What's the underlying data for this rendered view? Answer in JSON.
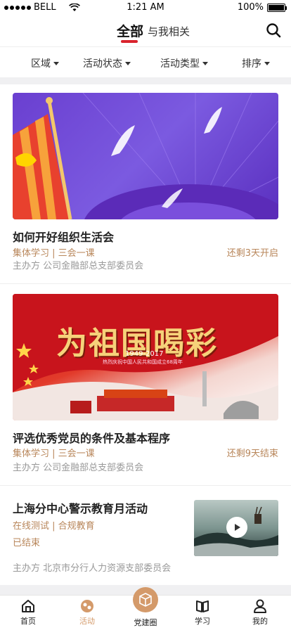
{
  "status_bar": {
    "carrier": "BELL",
    "time": "1:21 AM",
    "battery": "100%"
  },
  "top_tabs": {
    "all": "全部",
    "mine": "与我相关"
  },
  "filters": [
    "区域",
    "活动状态",
    "活动类型",
    "排序"
  ],
  "cards": [
    {
      "title": "如何开好组织生活会",
      "tags": "集体学习 | 三会一课",
      "status": "还剩3天开启",
      "host": "主办方  公司金融部总支部委员会"
    },
    {
      "title": "评选优秀党员的条件及基本程序",
      "tags": "集体学习 | 三会一课",
      "status": "还剩9天结束",
      "host": "主办方  公司金融部总支部委员会",
      "banner_text": "为祖国喝彩",
      "banner_years": "1949-2017",
      "banner_sub": "热烈庆祝中国人民共和国成立68周年"
    },
    {
      "title": "上海分中心警示教育月活动",
      "tags": "在线测试 | 合规教育",
      "status": "已结束",
      "host": "主办方  北京市分行人力资源支部委员会"
    }
  ],
  "bottom_tabs": [
    "首页",
    "活动",
    "党建圈",
    "学习",
    "我的"
  ],
  "colors": {
    "accent": "#d9232d",
    "tag": "#b8865a",
    "tab_active": "#d49a6a"
  }
}
